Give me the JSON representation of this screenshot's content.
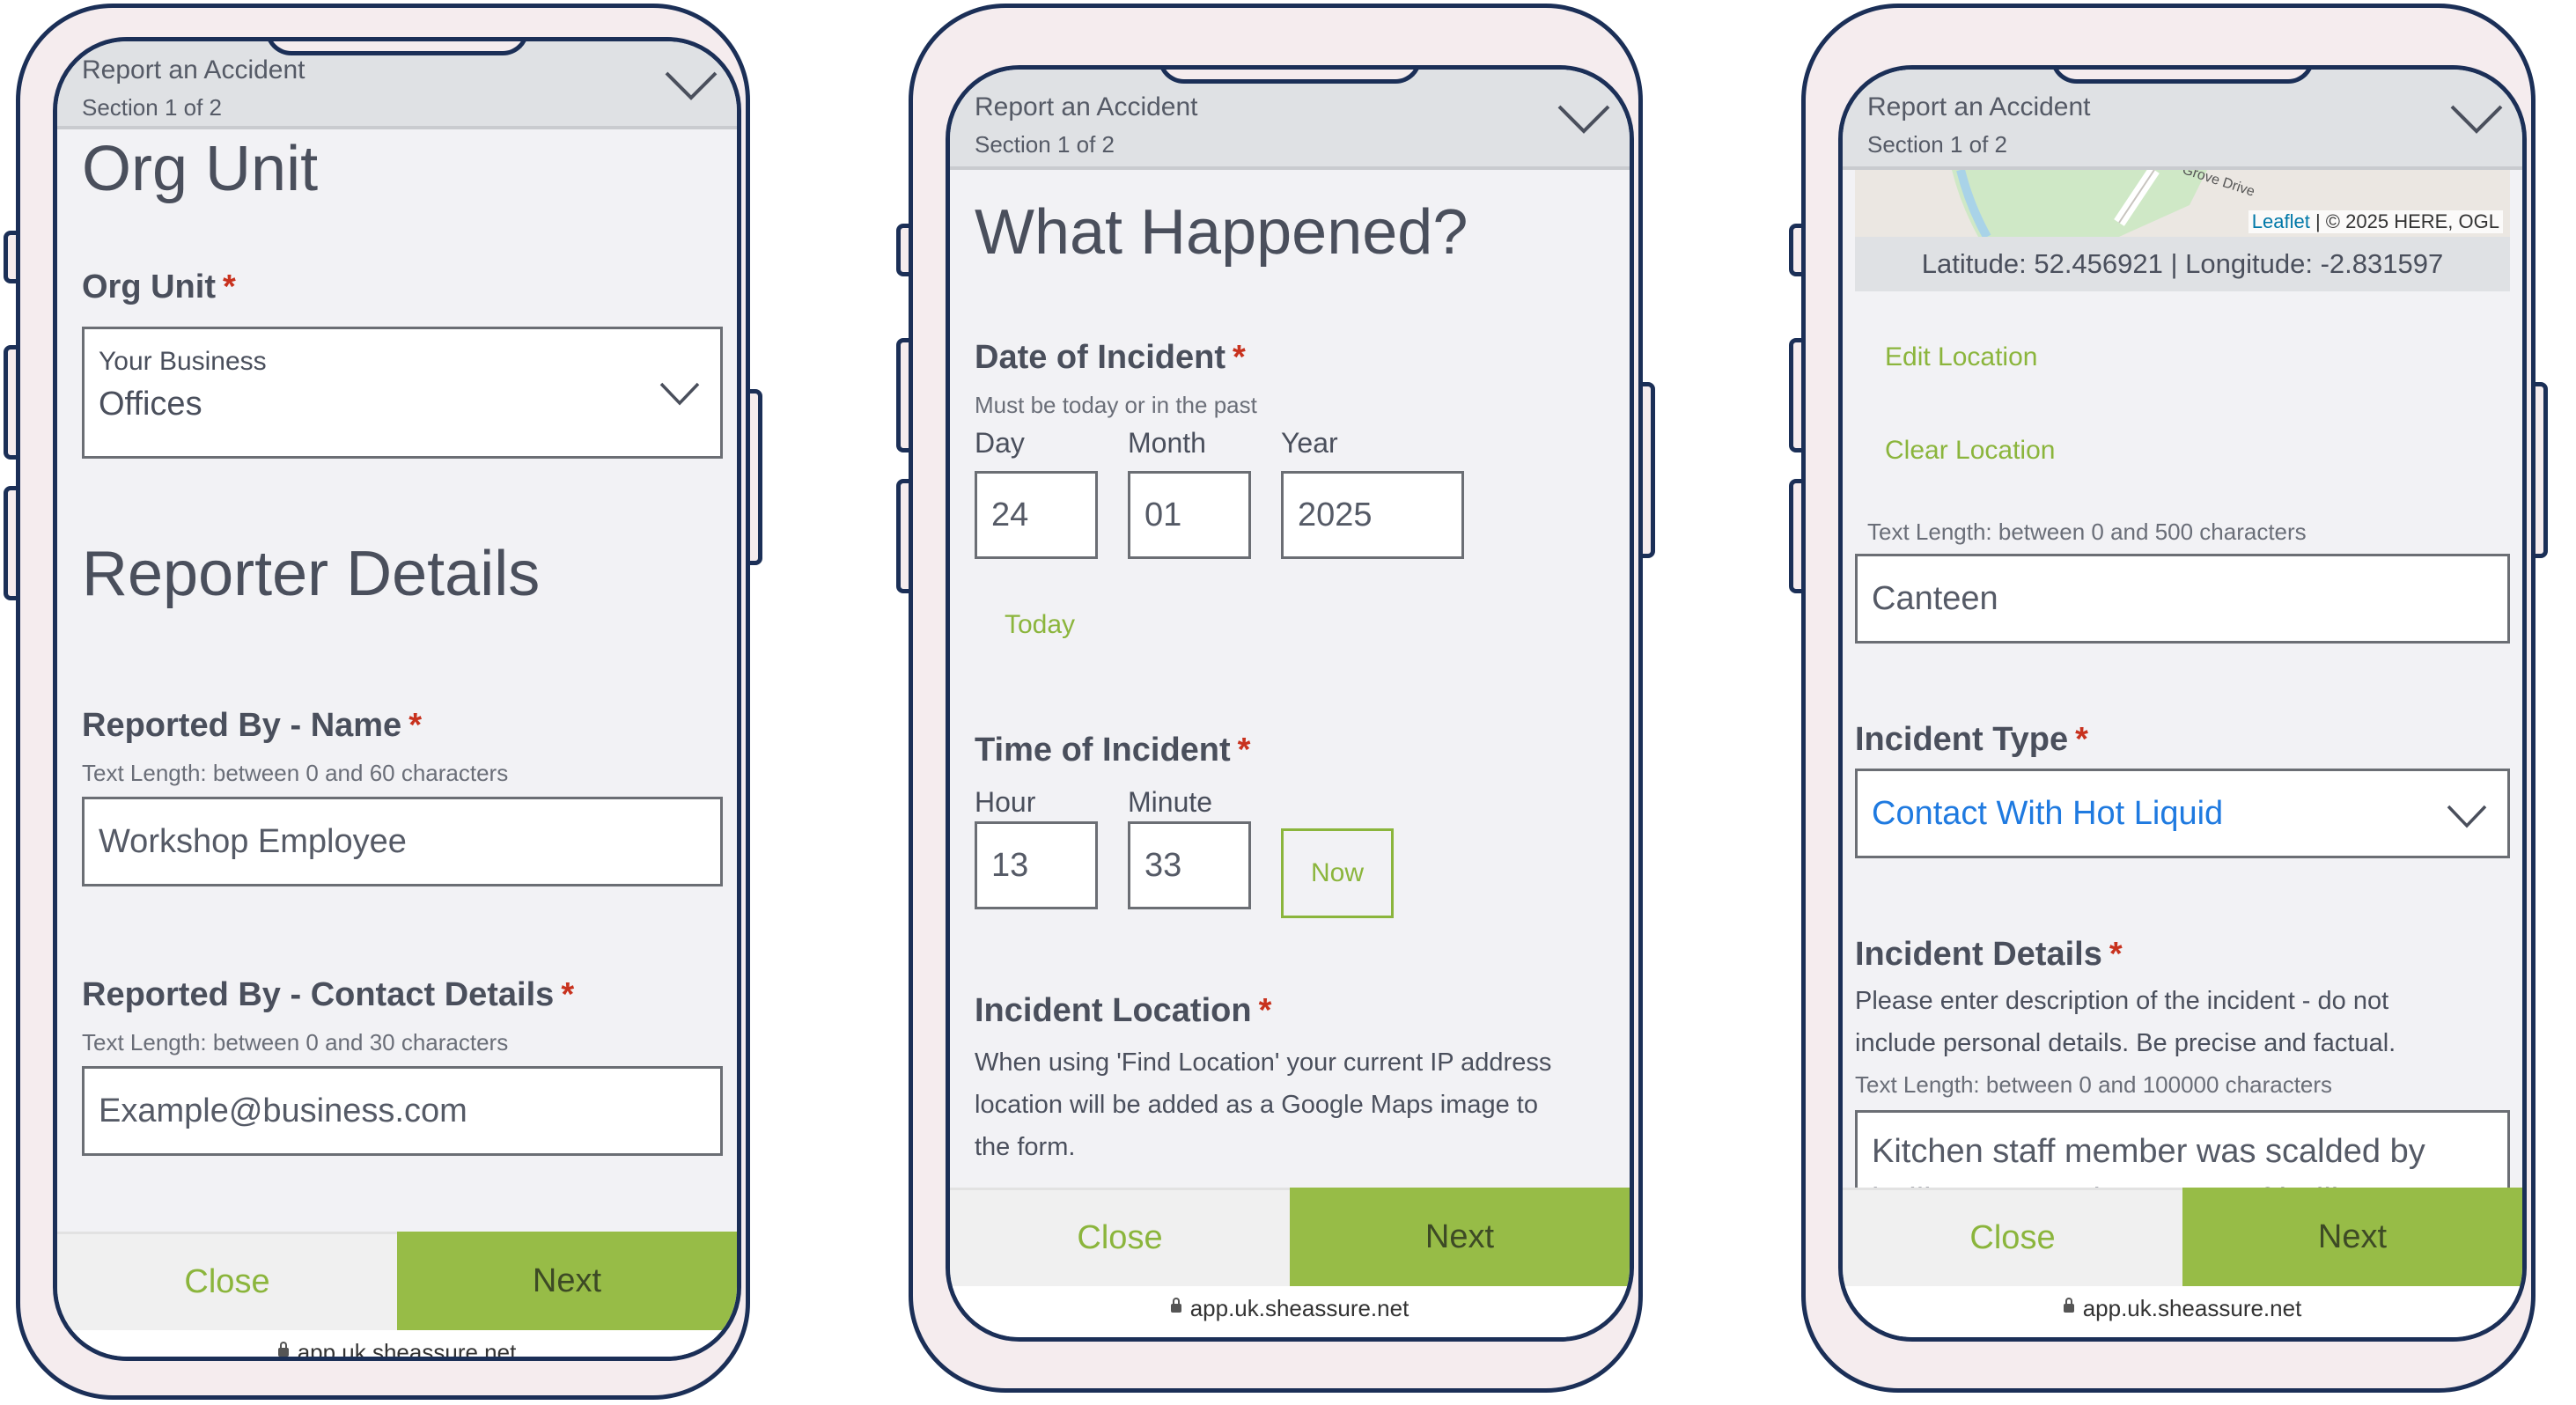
{
  "url": "app.uk.sheassure.net",
  "header": {
    "title": "Report an Accident",
    "section": "Section 1 of 2"
  },
  "footer": {
    "close": "Close",
    "next": "Next"
  },
  "colors": {
    "accent_green": "#97bc47",
    "link_green": "#8bb53c",
    "required_red": "#c8321e",
    "select_blue": "#1f7ae0",
    "frame_navy": "#1b2f57"
  },
  "screen1": {
    "org_unit_heading": "Org Unit",
    "org_unit_label": "Org Unit",
    "org_unit_line1": "Your Business",
    "org_unit_line2": "Offices",
    "reporter_heading": "Reporter Details",
    "name_label": "Reported By - Name",
    "name_hint": "Text Length: between 0 and 60 characters",
    "name_value": "Workshop Employee",
    "contact_label": "Reported By - Contact Details",
    "contact_hint": "Text Length: between 0 and 30 characters",
    "contact_value": "Example@business.com"
  },
  "screen2": {
    "heading": "What Happened?",
    "date_label": "Date of Incident",
    "date_hint": "Must be today or in the past",
    "day_label": "Day",
    "day_value": "24",
    "month_label": "Month",
    "month_value": "01",
    "year_label": "Year",
    "year_value": "2025",
    "today_link": "Today",
    "time_label": "Time of Incident",
    "hour_label": "Hour",
    "hour_value": "13",
    "minute_label": "Minute",
    "minute_value": "33",
    "now_button": "Now",
    "location_label": "Incident Location",
    "location_desc_1": "When using 'Find Location' your current IP address",
    "location_desc_2": "location will be added as a Google Maps image to",
    "location_desc_3": "the form."
  },
  "screen3": {
    "map_road": "Grove Drive",
    "map_attrib_link": "Leaflet",
    "map_attrib_text": "| © 2025 HERE, OGL",
    "latlng": "Latitude: 52.456921 | Longitude: -2.831597",
    "edit_location": "Edit Location",
    "clear_location": "Clear Location",
    "loc_text_hint": "Text Length: between 0 and 500 characters",
    "loc_text_value": "Canteen",
    "type_label": "Incident Type",
    "type_value": "Contact With Hot Liquid",
    "details_label": "Incident Details",
    "details_desc_1": "Please enter description of the incident - do not",
    "details_desc_2": "include personal details. Be precise and factual.",
    "details_hint": "Text Length: between 0 and 100000 characters",
    "details_line1": "Kitchen staff member was scalded by",
    "details_line2": "boiling water when a pot of boiling water"
  }
}
